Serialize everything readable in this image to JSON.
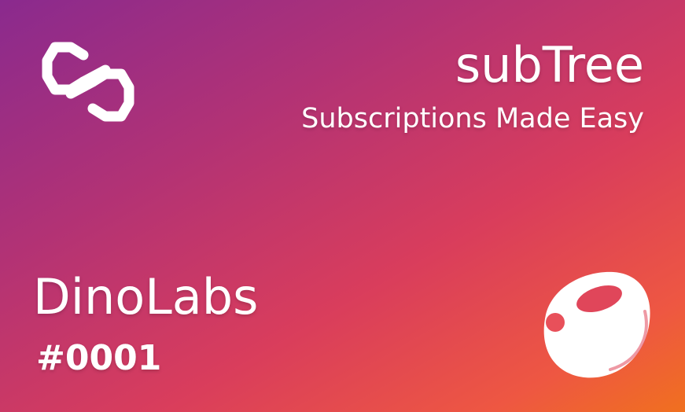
{
  "header": {
    "title": "subTree",
    "subtitle": "Subscriptions Made Easy"
  },
  "card": {
    "org_name": "DinoLabs",
    "serial": "#0001"
  },
  "icons": {
    "top_left": "linked-hexagons-logo-icon",
    "bottom_right": "dino-egg-icon"
  },
  "colors": {
    "gradient": [
      "#8a2a8e",
      "#b23275",
      "#d93d5c",
      "#ee5742",
      "#f0701f"
    ],
    "text": "#ffffff"
  }
}
